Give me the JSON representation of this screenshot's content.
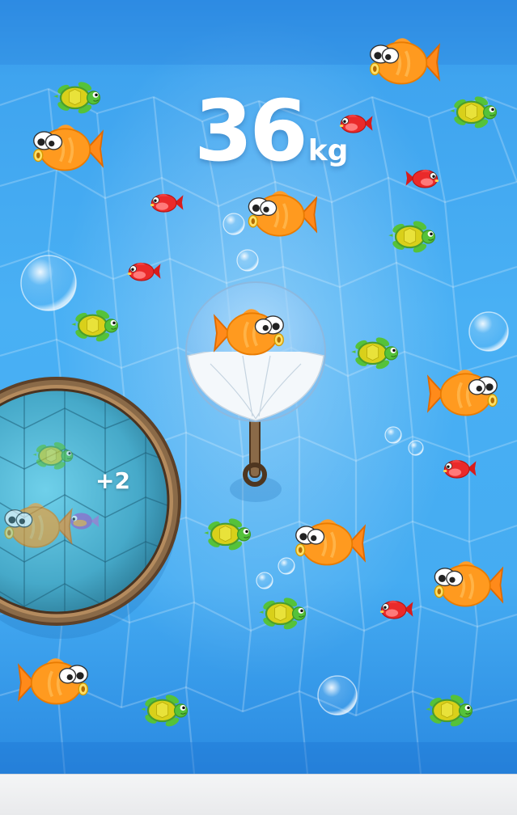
{
  "game": {
    "score_value": "36",
    "score_unit": "kg",
    "bucket_count": "+2"
  },
  "icons": {
    "goldfish": "goldfish-icon",
    "red_fish": "red-fish-icon",
    "turtle": "sea-turtle-icon",
    "purple_fish": "purple-fish-icon",
    "bubble": "bubble-icon",
    "net": "fishing-net-icon",
    "bucket": "bucket-icon"
  },
  "colors": {
    "water": "#45acf2",
    "water_dark": "#2e8fe4",
    "goldfish": "#ff9a1f",
    "red_fish": "#ea2a2a",
    "turtle_shell": "#d9d01a",
    "turtle_skin": "#55c23a",
    "bucket_rim": "#7a5a3a",
    "score_text": "#ffffff"
  }
}
